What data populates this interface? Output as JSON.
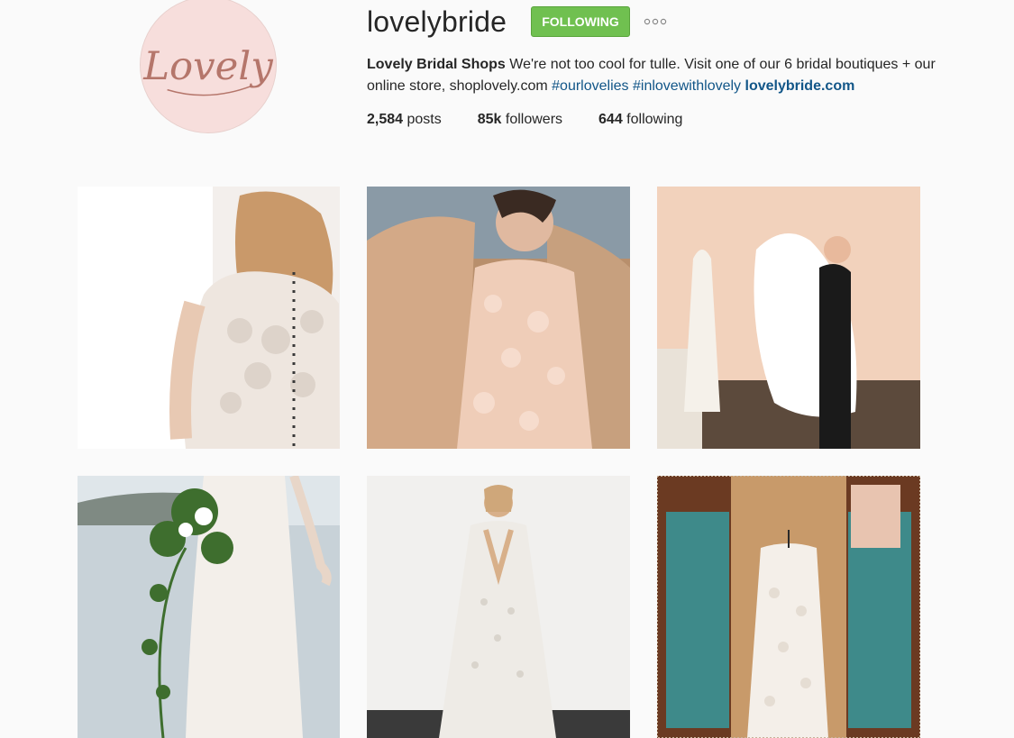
{
  "profile": {
    "username": "lovelybride",
    "follow_label": "FOLLOWING",
    "avatar_text": "Lovely",
    "bio": {
      "name": "Lovely Bridal Shops",
      "text_part1": " We're not too cool for tulle. Visit one of our 6 bridal boutiques + our online store, shoplovely.com ",
      "hashtag1": "#ourlovelies",
      "hashtag2": "#inlovewithlovely",
      "link": "lovelybride.com"
    },
    "stats": {
      "posts_count": "2,584",
      "posts_label": " posts",
      "followers_count": "85k",
      "followers_label": " followers",
      "following_count": "644",
      "following_label": " following"
    }
  },
  "colors": {
    "background": "#fafafa",
    "follow_button": "#70c050",
    "link": "#125688",
    "avatar_bg": "#f7dedc",
    "avatar_script": "#b5766b"
  },
  "posts": [
    {
      "subject": "lace back bridal gown"
    },
    {
      "subject": "bride in blush floral gown on sofa"
    },
    {
      "subject": "stylist with gown in boutique"
    },
    {
      "subject": "bride with bouquet by lake"
    },
    {
      "subject": "bride in beaded v-neck gown"
    },
    {
      "subject": "lace gown hanging in boutique"
    }
  ]
}
